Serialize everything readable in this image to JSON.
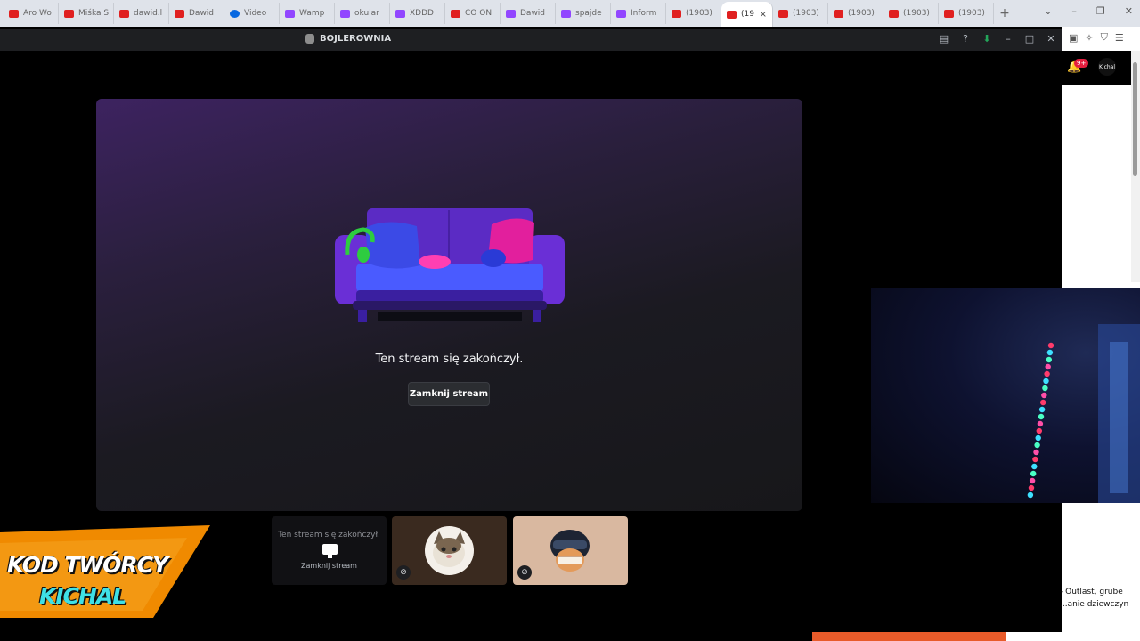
{
  "browser": {
    "tabs": [
      {
        "label": "Aro Wo",
        "kind": "yt"
      },
      {
        "label": "Miśka S",
        "kind": "yt"
      },
      {
        "label": "dawid.l",
        "kind": "yt"
      },
      {
        "label": "Dawid",
        "kind": "yt"
      },
      {
        "label": "Video",
        "kind": "mt"
      },
      {
        "label": "Wamp",
        "kind": "tw"
      },
      {
        "label": "okular",
        "kind": "tw"
      },
      {
        "label": "XDDD",
        "kind": "tw"
      },
      {
        "label": "CO ON",
        "kind": "yt"
      },
      {
        "label": "Dawid",
        "kind": "tw"
      },
      {
        "label": "spajde",
        "kind": "tw"
      },
      {
        "label": "Inform",
        "kind": "tw"
      },
      {
        "label": "(1903)",
        "kind": "yt"
      },
      {
        "label": "(19",
        "kind": "yt",
        "active": true
      },
      {
        "label": "(1903)",
        "kind": "yt"
      },
      {
        "label": "(1903)",
        "kind": "yt"
      },
      {
        "label": "(1903)",
        "kind": "yt"
      },
      {
        "label": "(1903)",
        "kind": "yt"
      }
    ],
    "new_tab": "+",
    "notification_badge": "9+",
    "avatar_text": "Kichal",
    "side_text": "- Outlast, grube ...anie dziewczyn"
  },
  "discord": {
    "server_name": "BOJLEROWNIA",
    "stream_ended": "Ten stream się zakończył.",
    "close_stream": "Zamknij stream",
    "tile_ended": "Ten stream się zakończył.",
    "tile_close": "Zamknij stream"
  },
  "overlay": {
    "promo_line1": "KOD TWÓRCY",
    "promo_line2": "KICHAL"
  },
  "colors": {
    "accent_youtube": "#e02020",
    "accent_twitch": "#9146ff",
    "promo_cyan": "#3ee0e6",
    "promo_orange": "#f08a00"
  }
}
